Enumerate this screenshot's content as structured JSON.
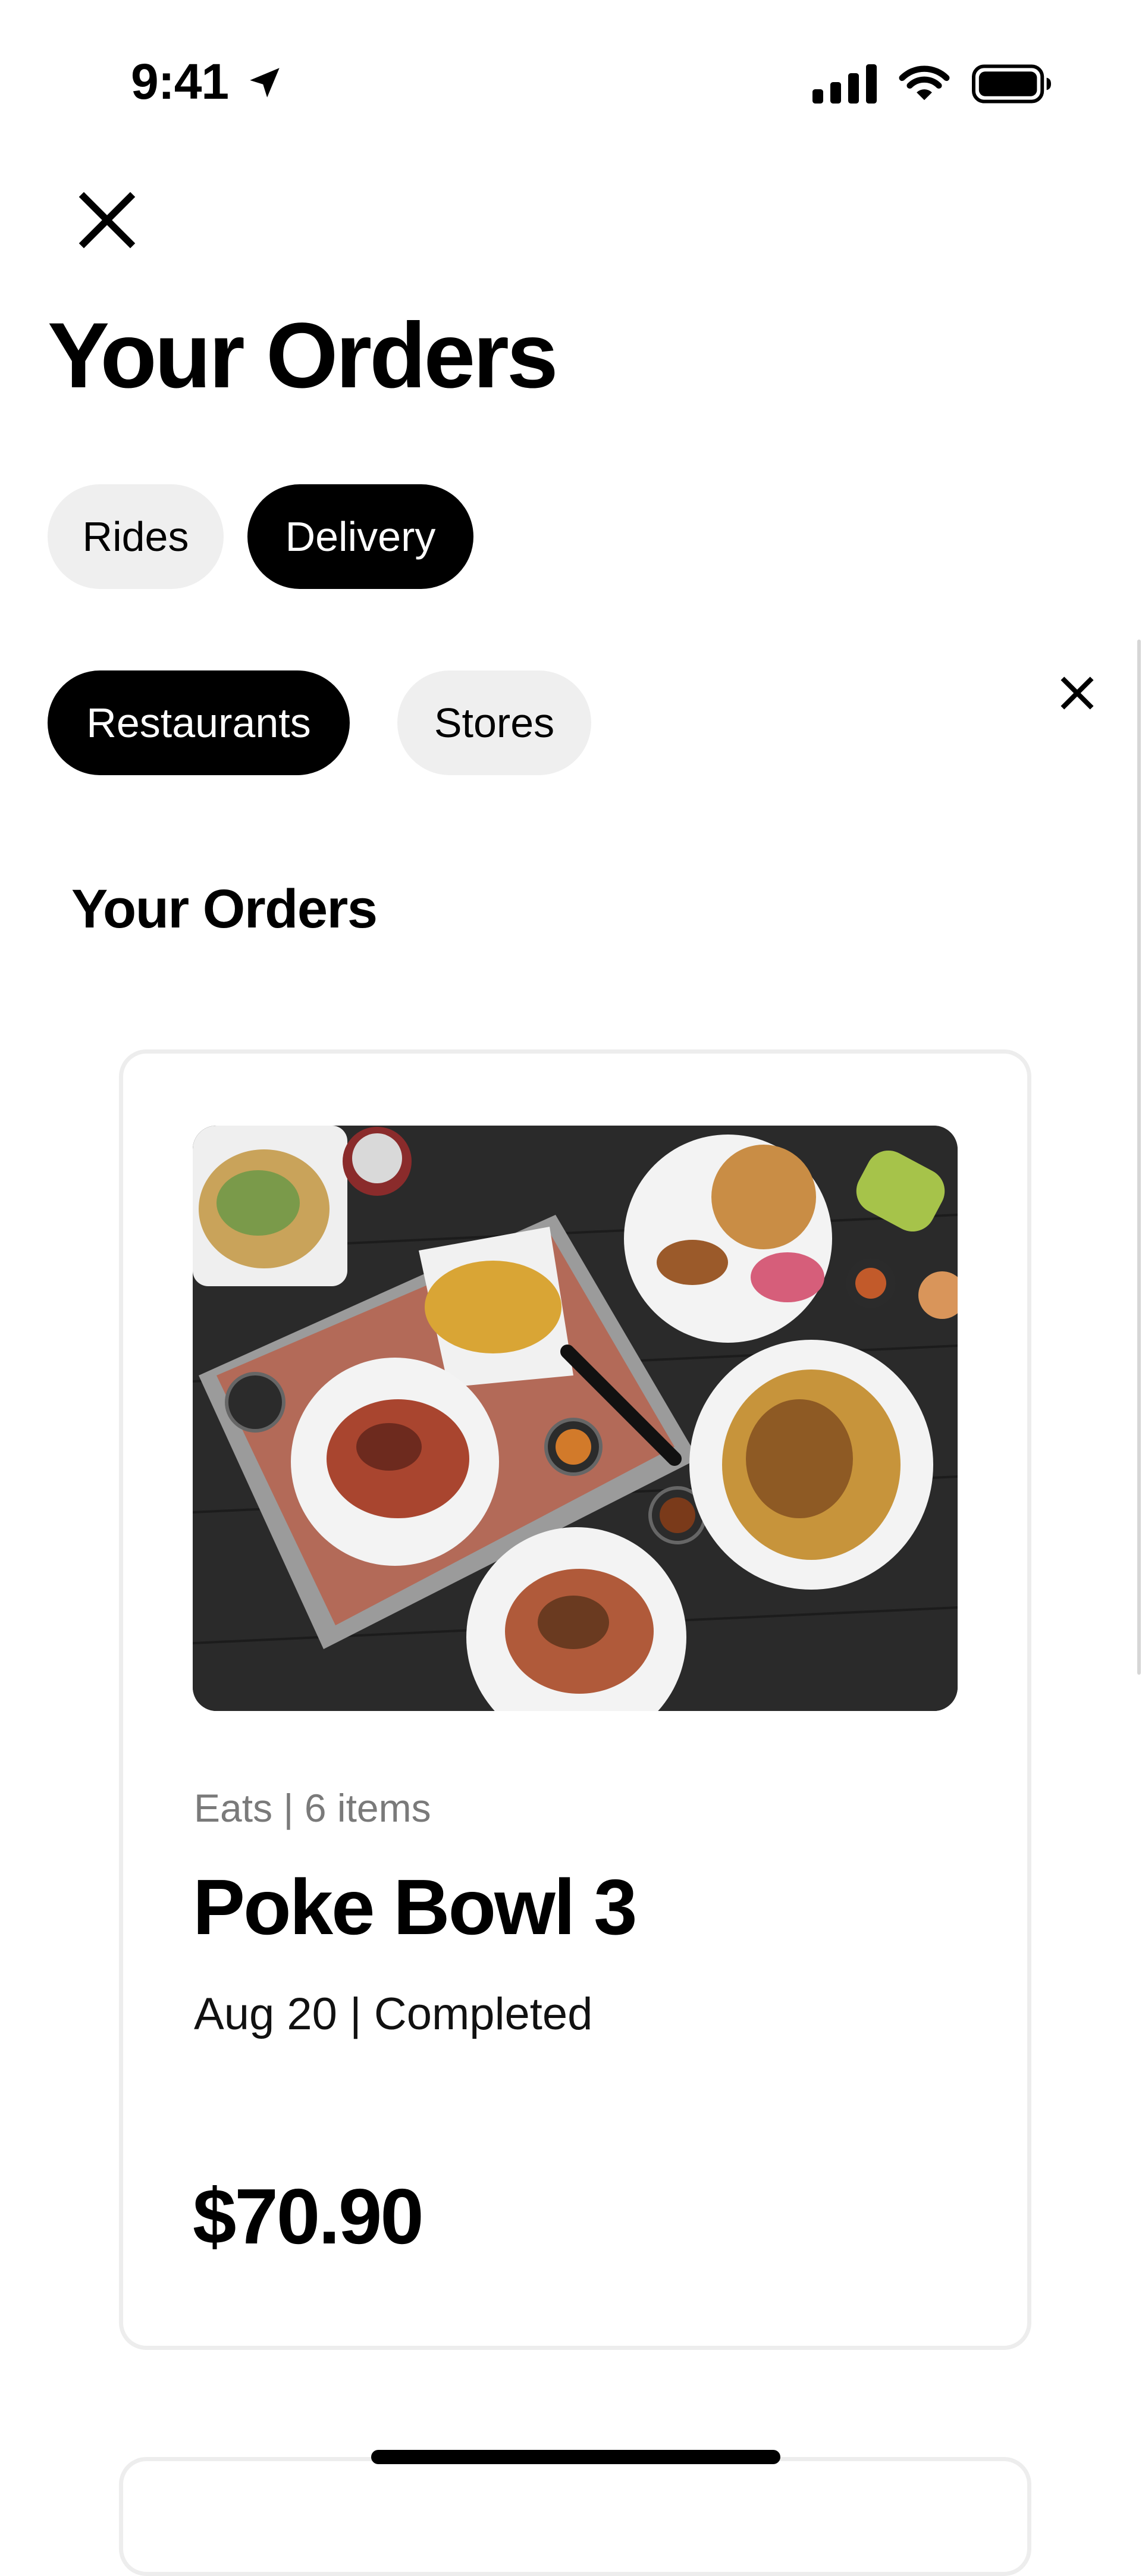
{
  "status_bar": {
    "time": "9:41"
  },
  "header": {
    "title": "Your Orders"
  },
  "tabs": [
    {
      "label": "Rides",
      "selected": false
    },
    {
      "label": "Delivery",
      "selected": true
    }
  ],
  "filters": [
    {
      "label": "Restaurants",
      "selected": true
    },
    {
      "label": "Stores",
      "selected": false
    }
  ],
  "section": {
    "title": "Your Orders"
  },
  "orders": [
    {
      "meta": "Eats | 6 items",
      "restaurant": "Poke Bowl 3",
      "date_status": "Aug 20 | Completed",
      "price": "$70.90"
    }
  ],
  "colors": {
    "selected_pill": "#000000",
    "unselected_pill": "#efefef",
    "card_border": "#ededed",
    "meta_text": "#7a7a7a"
  }
}
